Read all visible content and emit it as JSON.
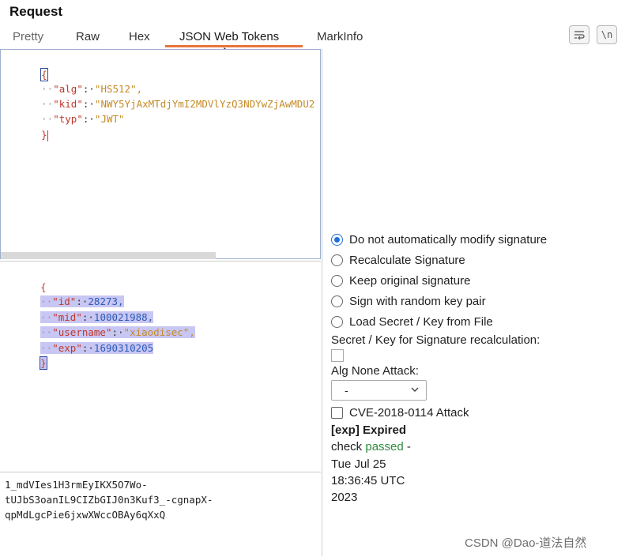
{
  "window": {
    "title": "Request"
  },
  "tabs": [
    {
      "label": "Pretty"
    },
    {
      "label": "Raw"
    },
    {
      "label": "Hex"
    },
    {
      "label": "JSON Web Tokens"
    },
    {
      "label": "MarkInfo"
    }
  ],
  "toolbar": {
    "wrap_icon": "wrap-lines-icon",
    "newline_label": "\\n"
  },
  "header_json": {
    "open": "{",
    "lines": [
      {
        "key": "\"alg\"",
        "value": "\"HS512\","
      },
      {
        "key": "\"kid\"",
        "value": "\"NWY5YjAxMTdjYmI2MDVlYzQ3NDYwZjAwMDU2"
      },
      {
        "key": "\"typ\"",
        "value": "\"JWT\""
      }
    ],
    "close": "}"
  },
  "payload_json": {
    "open": "{",
    "lines": [
      {
        "key": "\"id\"",
        "value": "28273,"
      },
      {
        "key": "\"mid\"",
        "value": "100021988,"
      },
      {
        "key": "\"username\"",
        "value": "\"xiaodisec\","
      },
      {
        "key": "\"exp\"",
        "value": "1690310205"
      }
    ],
    "close": "}"
  },
  "signature": {
    "lines": [
      "1_mdVIes1H3rmEyIKX5O7Wo-",
      "tUJbS3oanIL9CIZbGIJ0n3Kuf3_-cgnapX-",
      "qpMdLgcPie6jxwXWccOBAy6qXxQ"
    ]
  },
  "options": {
    "radios": [
      {
        "label": "Do not automatically modify signature",
        "selected": true
      },
      {
        "label": "Recalculate Signature",
        "selected": false
      },
      {
        "label": "Keep original signature",
        "selected": false
      },
      {
        "label": "Sign with random key pair",
        "selected": false
      },
      {
        "label": "Load Secret / Key from File",
        "selected": false
      }
    ],
    "secret_label": "Secret / Key for Signature recalculation:",
    "alg_none_label": "Alg None Attack:",
    "alg_none_value": "-",
    "cve_label": "CVE-2018-0114 Attack",
    "cve_checked": false,
    "exp_heading": "[exp] Expired",
    "check_prefix": "check",
    "check_status": "passed",
    "check_suffix": " -",
    "date_line1": "Tue Jul 25",
    "date_line2": "18:36:45 UTC",
    "date_line3": "2023"
  },
  "watermark": "CSDN @Dao-道法自然",
  "colors": {
    "accent_tab": "#e8753d",
    "radio_selected": "#1f6fd8",
    "passed": "#2e8b3e",
    "highlight": "#c8c6f2"
  }
}
